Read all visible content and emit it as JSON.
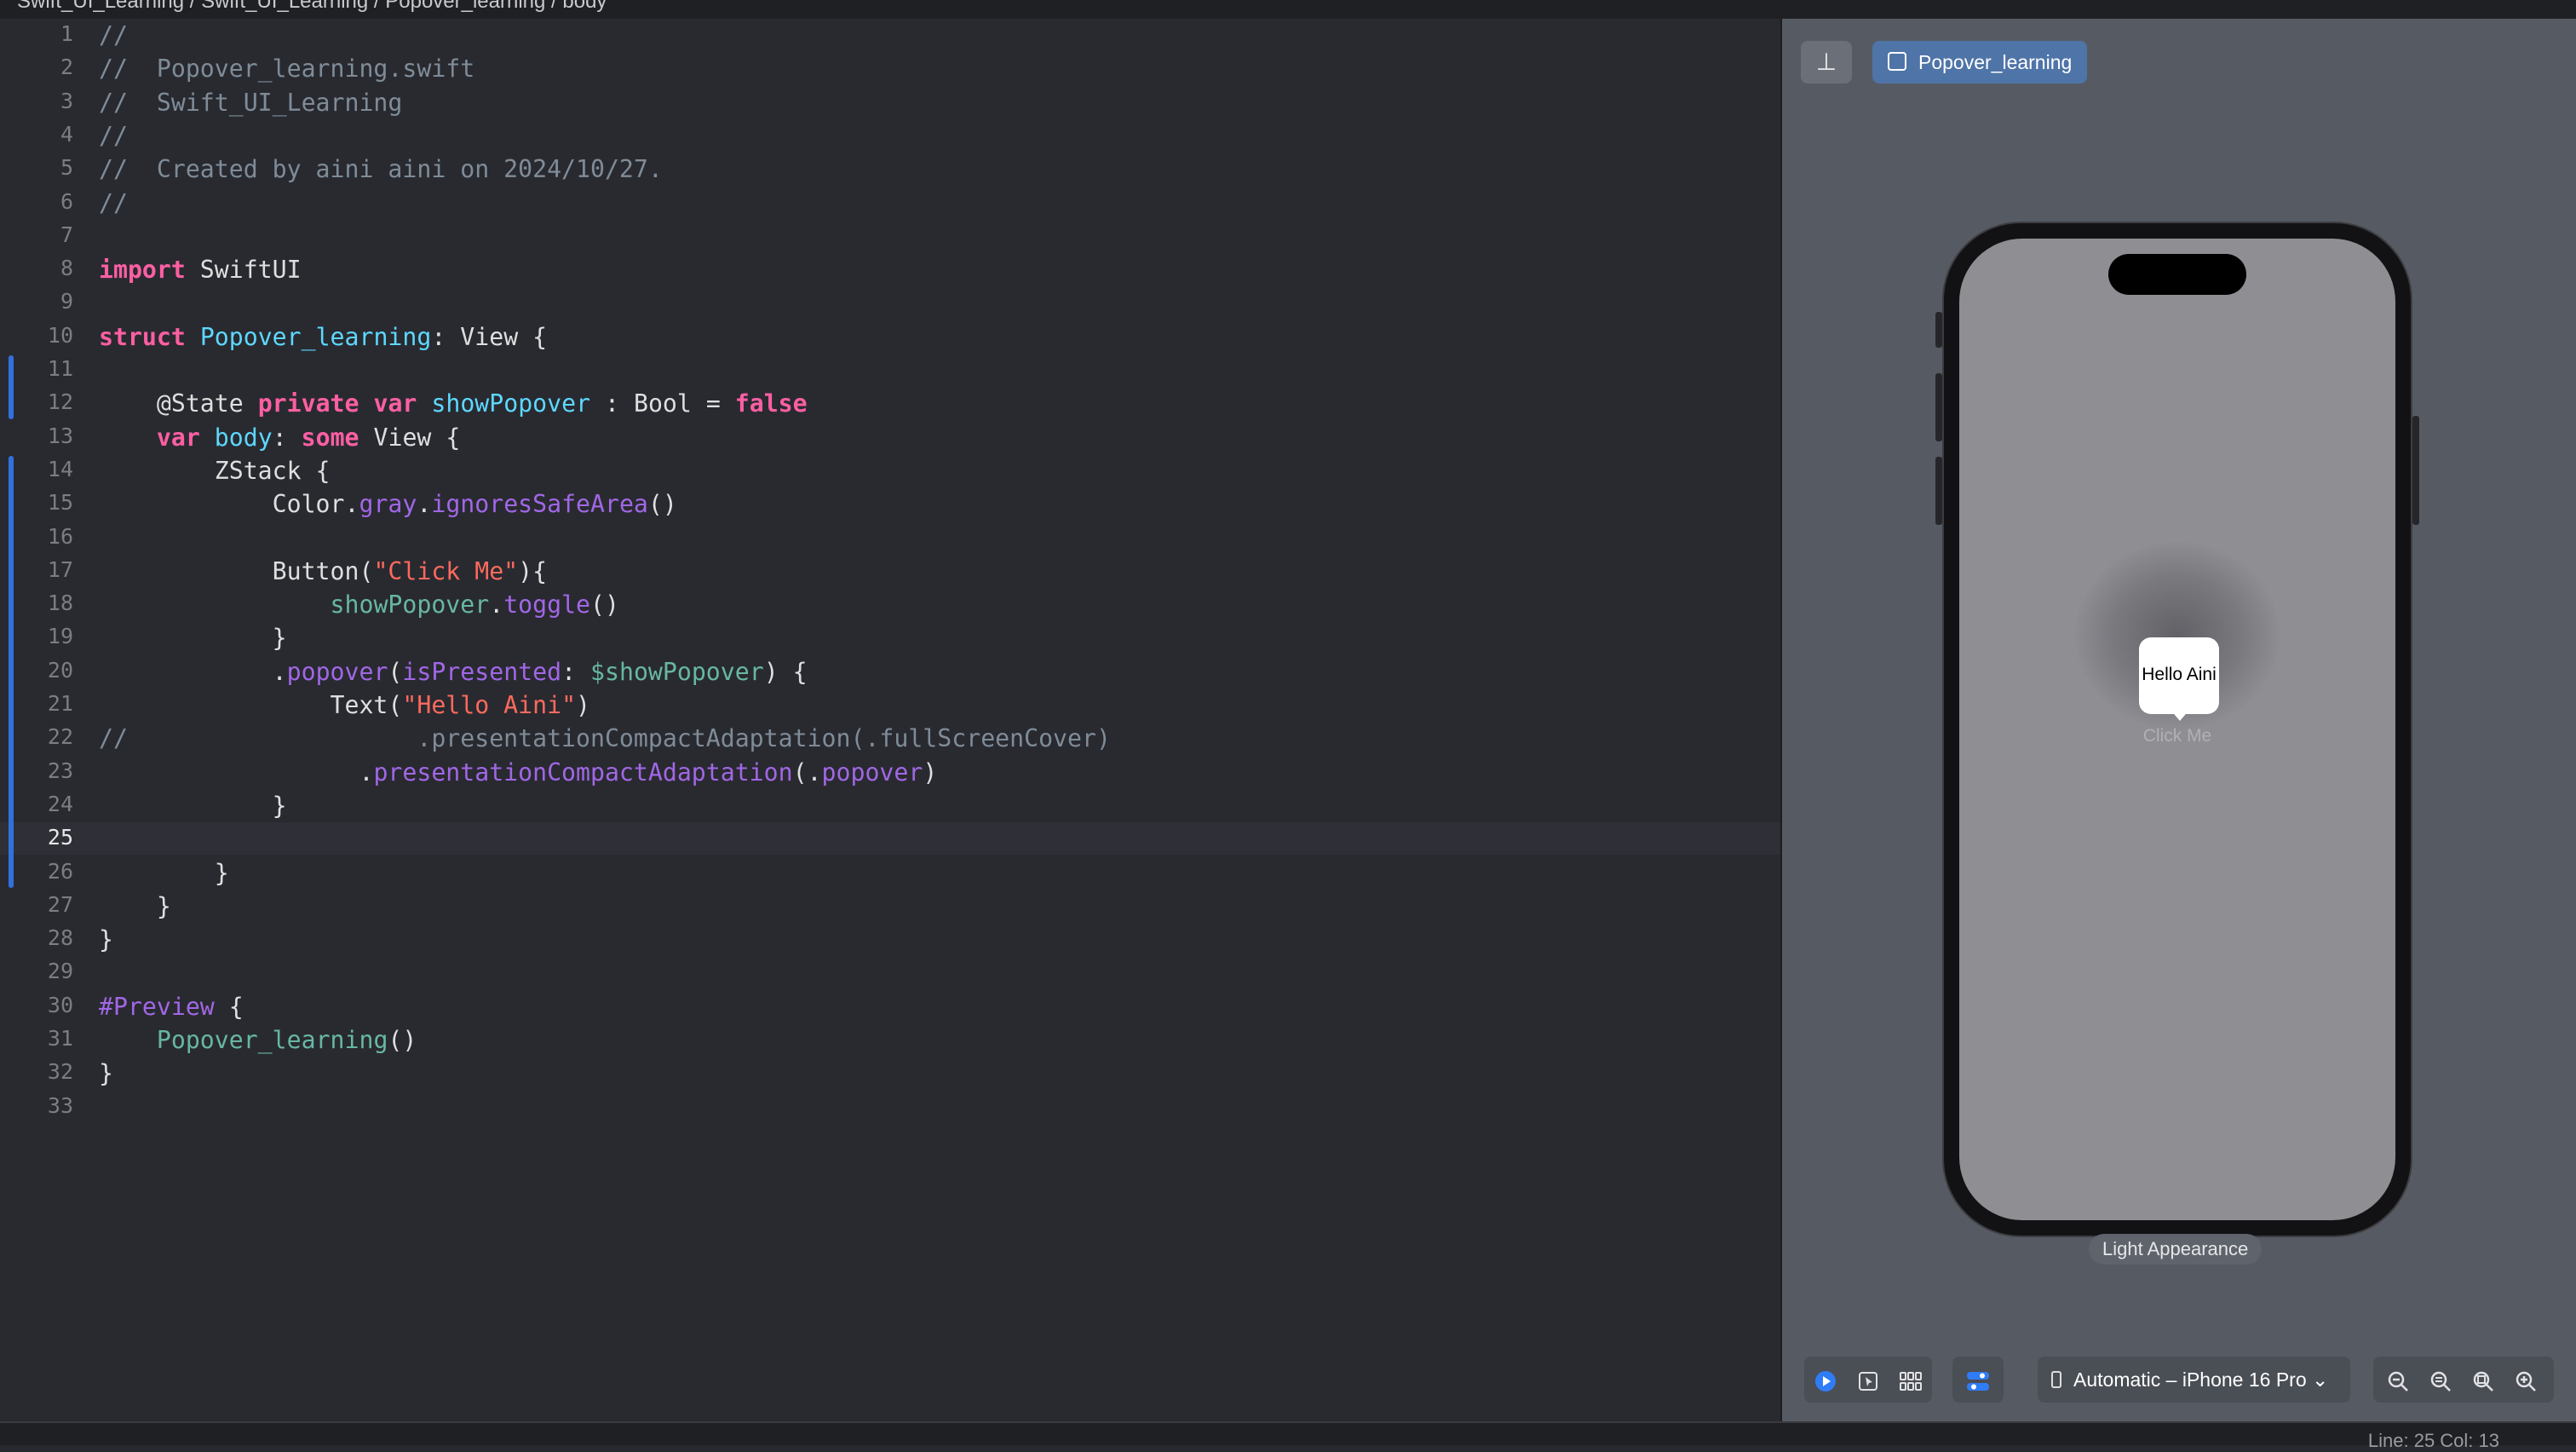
{
  "breadcrumb": [
    "Swift_UI_Learning",
    "Swift_UI_Learning",
    "Popover_learning",
    "body"
  ],
  "editor": {
    "current_line": 25,
    "lines": [
      [
        {
          "t": "//",
          "c": "c-com"
        }
      ],
      [
        {
          "t": "//  Popover_learning.swift",
          "c": "c-com"
        }
      ],
      [
        {
          "t": "//  Swift_UI_Learning",
          "c": "c-com"
        }
      ],
      [
        {
          "t": "//",
          "c": "c-com"
        }
      ],
      [
        {
          "t": "//  Created by aini aini on 2024/10/27.",
          "c": "c-com"
        }
      ],
      [
        {
          "t": "//",
          "c": "c-com"
        }
      ],
      [],
      [
        {
          "t": "import",
          "c": "c-kw"
        },
        {
          "t": " SwiftUI",
          "c": "c-attr"
        }
      ],
      [],
      [
        {
          "t": "struct",
          "c": "c-kw"
        },
        {
          "t": " ",
          "c": ""
        },
        {
          "t": "Popover_learning",
          "c": "c-type"
        },
        {
          "t": ": ",
          "c": ""
        },
        {
          "t": "View",
          "c": "c-attr"
        },
        {
          "t": " {",
          "c": ""
        }
      ],
      [],
      [
        {
          "t": "    @State ",
          "c": "c-attr"
        },
        {
          "t": "private",
          "c": "c-kw"
        },
        {
          "t": " ",
          "c": ""
        },
        {
          "t": "var",
          "c": "c-kw"
        },
        {
          "t": " ",
          "c": ""
        },
        {
          "t": "showPopover",
          "c": "c-type"
        },
        {
          "t": " : Bool = ",
          "c": ""
        },
        {
          "t": "false",
          "c": "c-kw"
        }
      ],
      [
        {
          "t": "    ",
          "c": ""
        },
        {
          "t": "var",
          "c": "c-kw"
        },
        {
          "t": " ",
          "c": ""
        },
        {
          "t": "body",
          "c": "c-type"
        },
        {
          "t": ": ",
          "c": ""
        },
        {
          "t": "some",
          "c": "c-kw"
        },
        {
          "t": " View {",
          "c": ""
        }
      ],
      [
        {
          "t": "        ZStack {",
          "c": ""
        }
      ],
      [
        {
          "t": "            Color.",
          "c": ""
        },
        {
          "t": "gray",
          "c": "c-mem"
        },
        {
          "t": ".",
          "c": ""
        },
        {
          "t": "ignoresSafeArea",
          "c": "c-mem"
        },
        {
          "t": "()",
          "c": ""
        }
      ],
      [],
      [
        {
          "t": "            Button(",
          "c": ""
        },
        {
          "t": "\"Click Me\"",
          "c": "c-str"
        },
        {
          "t": "){",
          "c": ""
        }
      ],
      [
        {
          "t": "                ",
          "c": ""
        },
        {
          "t": "showPopover",
          "c": "c-dec"
        },
        {
          "t": ".",
          "c": ""
        },
        {
          "t": "toggle",
          "c": "c-mem"
        },
        {
          "t": "()",
          "c": ""
        }
      ],
      [
        {
          "t": "            }",
          "c": ""
        }
      ],
      [
        {
          "t": "            .",
          "c": ""
        },
        {
          "t": "popover",
          "c": "c-mem"
        },
        {
          "t": "(",
          "c": ""
        },
        {
          "t": "isPresented",
          "c": "c-mem"
        },
        {
          "t": ": ",
          "c": ""
        },
        {
          "t": "$showPopover",
          "c": "c-dec"
        },
        {
          "t": ") {",
          "c": ""
        }
      ],
      [
        {
          "t": "                Text(",
          "c": ""
        },
        {
          "t": "\"Hello Aini\"",
          "c": "c-str"
        },
        {
          "t": ")",
          "c": ""
        }
      ],
      [
        {
          "t": "//                    .presentationCompactAdaptation(.fullScreenCover)",
          "c": "c-com"
        }
      ],
      [
        {
          "t": "                  .",
          "c": ""
        },
        {
          "t": "presentationCompactAdaptation",
          "c": "c-mem"
        },
        {
          "t": "(.",
          "c": ""
        },
        {
          "t": "popover",
          "c": "c-mem"
        },
        {
          "t": ")",
          "c": ""
        }
      ],
      [
        {
          "t": "            }",
          "c": ""
        }
      ],
      [],
      [
        {
          "t": "        }",
          "c": ""
        }
      ],
      [
        {
          "t": "    }",
          "c": ""
        }
      ],
      [
        {
          "t": "}",
          "c": ""
        }
      ],
      [],
      [
        {
          "t": "#Preview",
          "c": "c-mem"
        },
        {
          "t": " {",
          "c": ""
        }
      ],
      [
        {
          "t": "    ",
          "c": ""
        },
        {
          "t": "Popover_learning",
          "c": "c-dec"
        },
        {
          "t": "()",
          "c": ""
        }
      ],
      [
        {
          "t": "}",
          "c": ""
        }
      ],
      []
    ]
  },
  "canvas": {
    "preview_tab_label": "Popover_learning",
    "pin_icon": "pin-icon",
    "popover_text": "Hello Aini",
    "button_text": "Click Me",
    "appearance_label": "Light Appearance",
    "device_selector": "Automatic – iPhone 16 Pro",
    "toolbar_icons": [
      "live-preview-icon",
      "selectable-icon",
      "variants-icon",
      "canvas-settings-icon"
    ],
    "zoom_icons": [
      "zoom-out-icon",
      "zoom-to-100-icon",
      "zoom-to-fit-icon",
      "zoom-in-icon"
    ]
  },
  "status": {
    "position": "Line: 25  Col: 13"
  }
}
